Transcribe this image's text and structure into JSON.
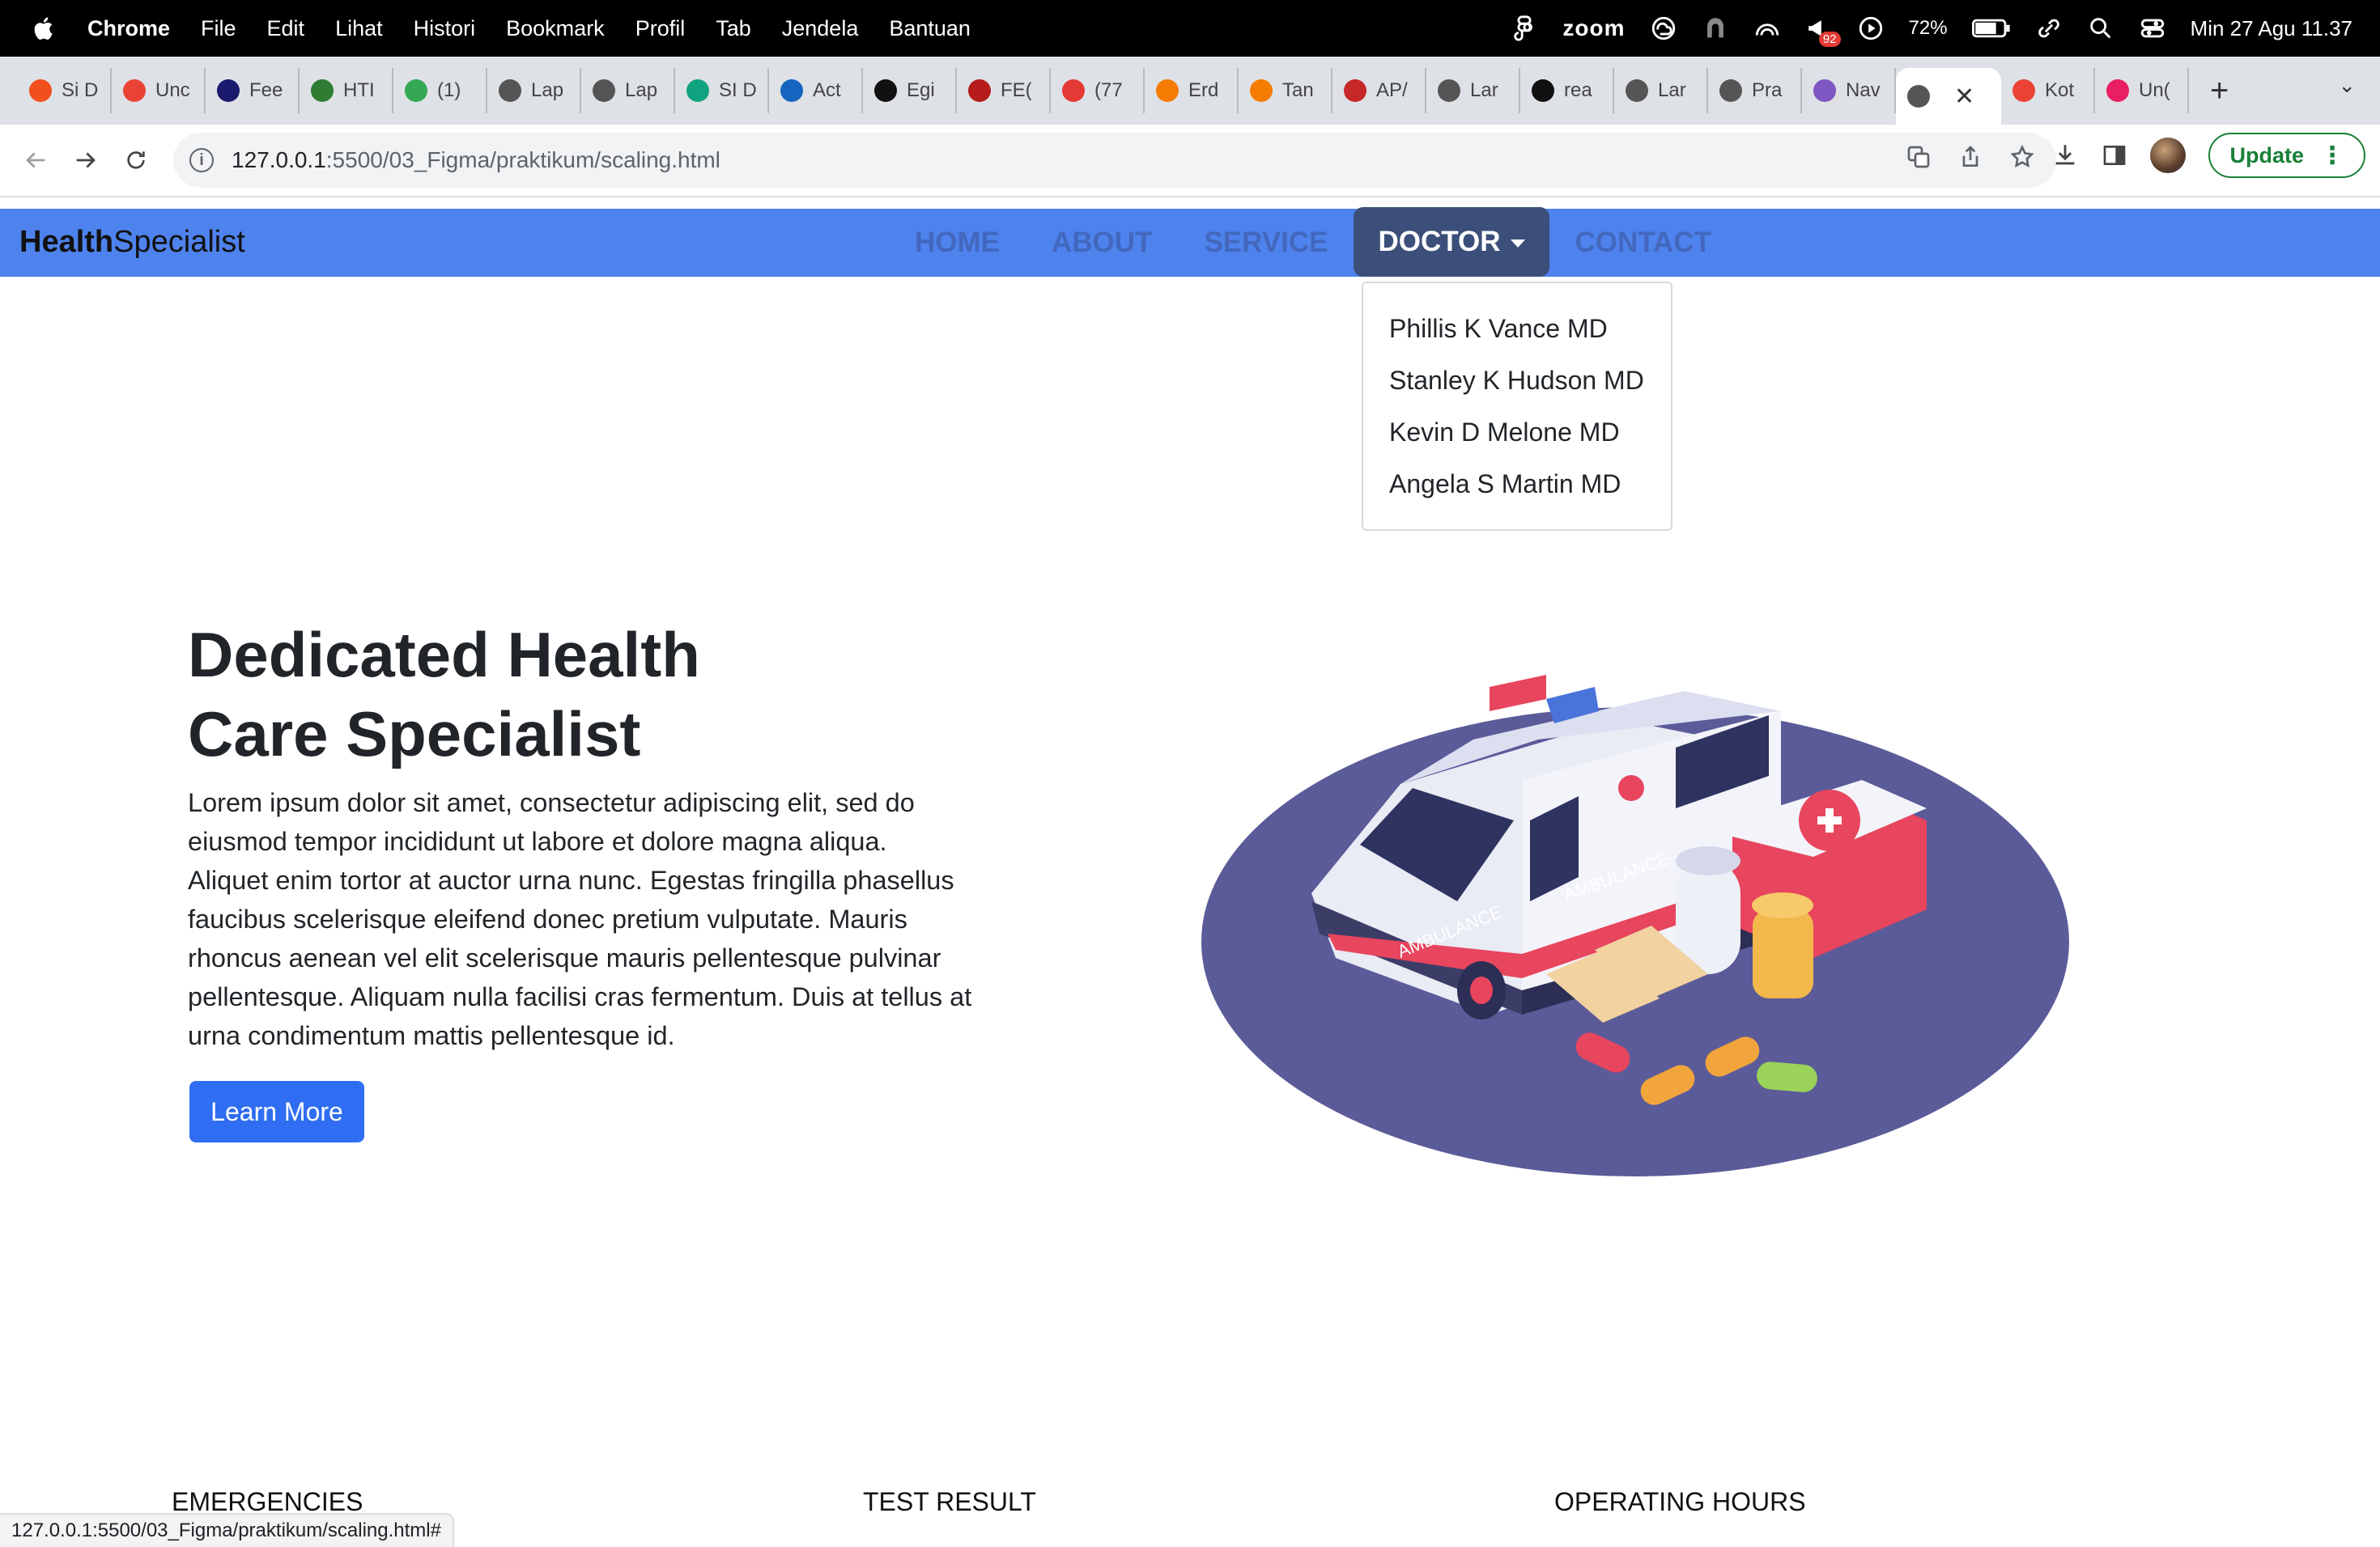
{
  "os_menubar": {
    "app": "Chrome",
    "items": [
      "File",
      "Edit",
      "Lihat",
      "Histori",
      "Bookmark",
      "Profil",
      "Tab",
      "Jendela",
      "Bantuan"
    ],
    "zoom_label": "zoom",
    "battery": "72%",
    "clock": "Min 27 Agu  11.37",
    "notif_badge": "92"
  },
  "tabs": [
    {
      "label": "Si D",
      "color": "#f24e1e"
    },
    {
      "label": "Unc",
      "color": "#ea4335"
    },
    {
      "label": "Fee",
      "color": "#1a1a6e"
    },
    {
      "label": "HTI",
      "color": "#2e7d32"
    },
    {
      "label": "(1)",
      "color": "#34a853"
    },
    {
      "label": "Lap",
      "color": "#555555"
    },
    {
      "label": "Lap",
      "color": "#555555"
    },
    {
      "label": "SI D",
      "color": "#10a37f"
    },
    {
      "label": "Act",
      "color": "#1565c0"
    },
    {
      "label": "Egi",
      "color": "#111111"
    },
    {
      "label": "FE(",
      "color": "#b71c1c"
    },
    {
      "label": "(77",
      "color": "#e53935"
    },
    {
      "label": "Erd",
      "color": "#f57c00"
    },
    {
      "label": "Tan",
      "color": "#f57c00"
    },
    {
      "label": "AP/",
      "color": "#c62828"
    },
    {
      "label": "Lar",
      "color": "#555555"
    },
    {
      "label": "rea",
      "color": "#111111"
    },
    {
      "label": "Lar",
      "color": "#555555"
    },
    {
      "label": "Pra",
      "color": "#555555"
    },
    {
      "label": "Nav",
      "color": "#7e57c2"
    },
    {
      "label": "",
      "color": "#555555",
      "active": true
    },
    {
      "label": "Kot",
      "color": "#ea4335"
    },
    {
      "label": "Un(",
      "color": "#e91e63"
    }
  ],
  "address": {
    "host": "127.0.0.1",
    "path": ":5500/03_Figma/praktikum/scaling.html"
  },
  "update_label": "Update",
  "site": {
    "brand_bold": "Health",
    "brand_rest": "Specialist",
    "nav": [
      "HOME",
      "ABOUT",
      "SERVICE",
      "DOCTOR",
      "CONTACT"
    ],
    "doctors": [
      "Phillis K Vance MD",
      "Stanley K Hudson MD",
      "Kevin D Melone MD",
      "Angela S Martin MD"
    ],
    "hero_title_1": "Dedicated Health",
    "hero_title_2": "Care Specialist",
    "hero_text": "Lorem ipsum dolor sit amet, consectetur adipiscing elit, sed do eiusmod tempor incididunt ut labore et dolore magna aliqua. Aliquet enim tortor at auctor urna nunc. Egestas fringilla phasellus faucibus scelerisque eleifend donec pretium vulputate. Mauris rhoncus aenean vel elit scelerisque mauris pellentesque pulvinar pellentesque. Aliquam nulla facilisi cras fermentum. Duis at tellus at urna condimentum mattis pellentesque id.",
    "cta": "Learn More",
    "sections": [
      "EMERGENCIES",
      "TEST RESULT",
      "OPERATING HOURS"
    ]
  },
  "status_url": "127.0.0.1:5500/03_Figma/praktikum/scaling.html#"
}
